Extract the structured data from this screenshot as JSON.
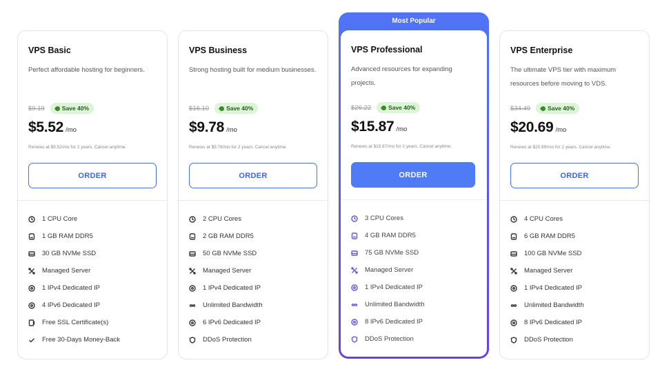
{
  "colors": {
    "accent": "#4f7bf6",
    "featured_gradient_top": "#4f75f5",
    "featured_gradient_bottom": "#6a3fe6",
    "save_bg": "#dcf5d6",
    "save_text": "#245a1d"
  },
  "plans": [
    {
      "name": "VPS Basic",
      "description": "Perfect affordable hosting for beginners.",
      "old_price": "$9.19",
      "save": "Save 40%",
      "price": "$5.52",
      "per": "/mo",
      "renews": "Renews at $5.52/mo for 2 years. Cancel anytime.",
      "order_label": "ORDER",
      "features": [
        {
          "icon": "cpu-icon",
          "label": "1 CPU Core"
        },
        {
          "icon": "ram-icon",
          "label": "1 GB RAM DDR5"
        },
        {
          "icon": "ssd-icon",
          "label": "30 GB NVMe SSD"
        },
        {
          "icon": "tools-icon",
          "label": "Managed Server"
        },
        {
          "icon": "ip-icon",
          "label": "1 IPv4 Dedicated IP"
        },
        {
          "icon": "ip-icon",
          "label": "4 IPv6 Dedicated IP"
        },
        {
          "icon": "ssl-icon",
          "label": "Free SSL Certificate(s)"
        },
        {
          "icon": "check-icon",
          "label": "Free 30-Days Money-Back"
        }
      ]
    },
    {
      "name": "VPS Business",
      "description": "Strong hosting built for medium businesses.",
      "old_price": "$16.10",
      "save": "Save 40%",
      "price": "$9.78",
      "per": "/mo",
      "renews": "Renews at $9.78/mo for 2 years. Cancel anytime.",
      "order_label": "ORDER",
      "features": [
        {
          "icon": "cpu-icon",
          "label": "2 CPU Cores"
        },
        {
          "icon": "ram-icon",
          "label": "2 GB RAM DDR5"
        },
        {
          "icon": "ssd-icon",
          "label": "50 GB NVMe SSD"
        },
        {
          "icon": "tools-icon",
          "label": "Managed Server"
        },
        {
          "icon": "ip-icon",
          "label": "1 IPv4 Dedicated IP"
        },
        {
          "icon": "infinity-icon",
          "label": "Unlimited Bandwidth"
        },
        {
          "icon": "ip-icon",
          "label": "6 IPv6 Dedicated IP"
        },
        {
          "icon": "shield-icon",
          "label": "DDoS Protection"
        }
      ]
    },
    {
      "badge": "Most Popular",
      "name": "VPS Professional",
      "description": "Advanced resources for expanding projects.",
      "old_price": "$26.22",
      "save": "Save 40%",
      "price": "$15.87",
      "per": "/mo",
      "renews": "Renews at $15.87/mo for 2 years. Cancel anytime.",
      "order_label": "ORDER",
      "features": [
        {
          "icon": "cpu-icon",
          "label": "3 CPU Cores"
        },
        {
          "icon": "ram-icon",
          "label": "4 GB RAM DDR5"
        },
        {
          "icon": "ssd-icon",
          "label": "75 GB NVMe SSD"
        },
        {
          "icon": "tools-icon",
          "label": "Managed Server"
        },
        {
          "icon": "ip-icon",
          "label": "1 IPv4 Dedicated IP"
        },
        {
          "icon": "infinity-icon",
          "label": "Unlimited Bandwidth"
        },
        {
          "icon": "ip-icon",
          "label": "8 IPv6 Dedicated IP"
        },
        {
          "icon": "shield-icon",
          "label": "DDoS Protection"
        }
      ]
    },
    {
      "name": "VPS Enterprise",
      "description": "The ultimate VPS tier with maximum resources before moving to VDS.",
      "old_price": "$34.49",
      "save": "Save 40%",
      "price": "$20.69",
      "per": "/mo",
      "renews": "Renews at $20.69/mo for 2 years. Cancel anytime.",
      "order_label": "ORDER",
      "features": [
        {
          "icon": "cpu-icon",
          "label": "4 CPU Cores"
        },
        {
          "icon": "ram-icon",
          "label": "6 GB RAM DDR5"
        },
        {
          "icon": "ssd-icon",
          "label": "100 GB NVMe SSD"
        },
        {
          "icon": "tools-icon",
          "label": "Managed Server"
        },
        {
          "icon": "ip-icon",
          "label": "1 IPv4 Dedicated IP"
        },
        {
          "icon": "infinity-icon",
          "label": "Unlimited Bandwidth"
        },
        {
          "icon": "ip-icon",
          "label": "8 IPv6 Dedicated IP"
        },
        {
          "icon": "shield-icon",
          "label": "DDoS Protection"
        }
      ]
    }
  ]
}
